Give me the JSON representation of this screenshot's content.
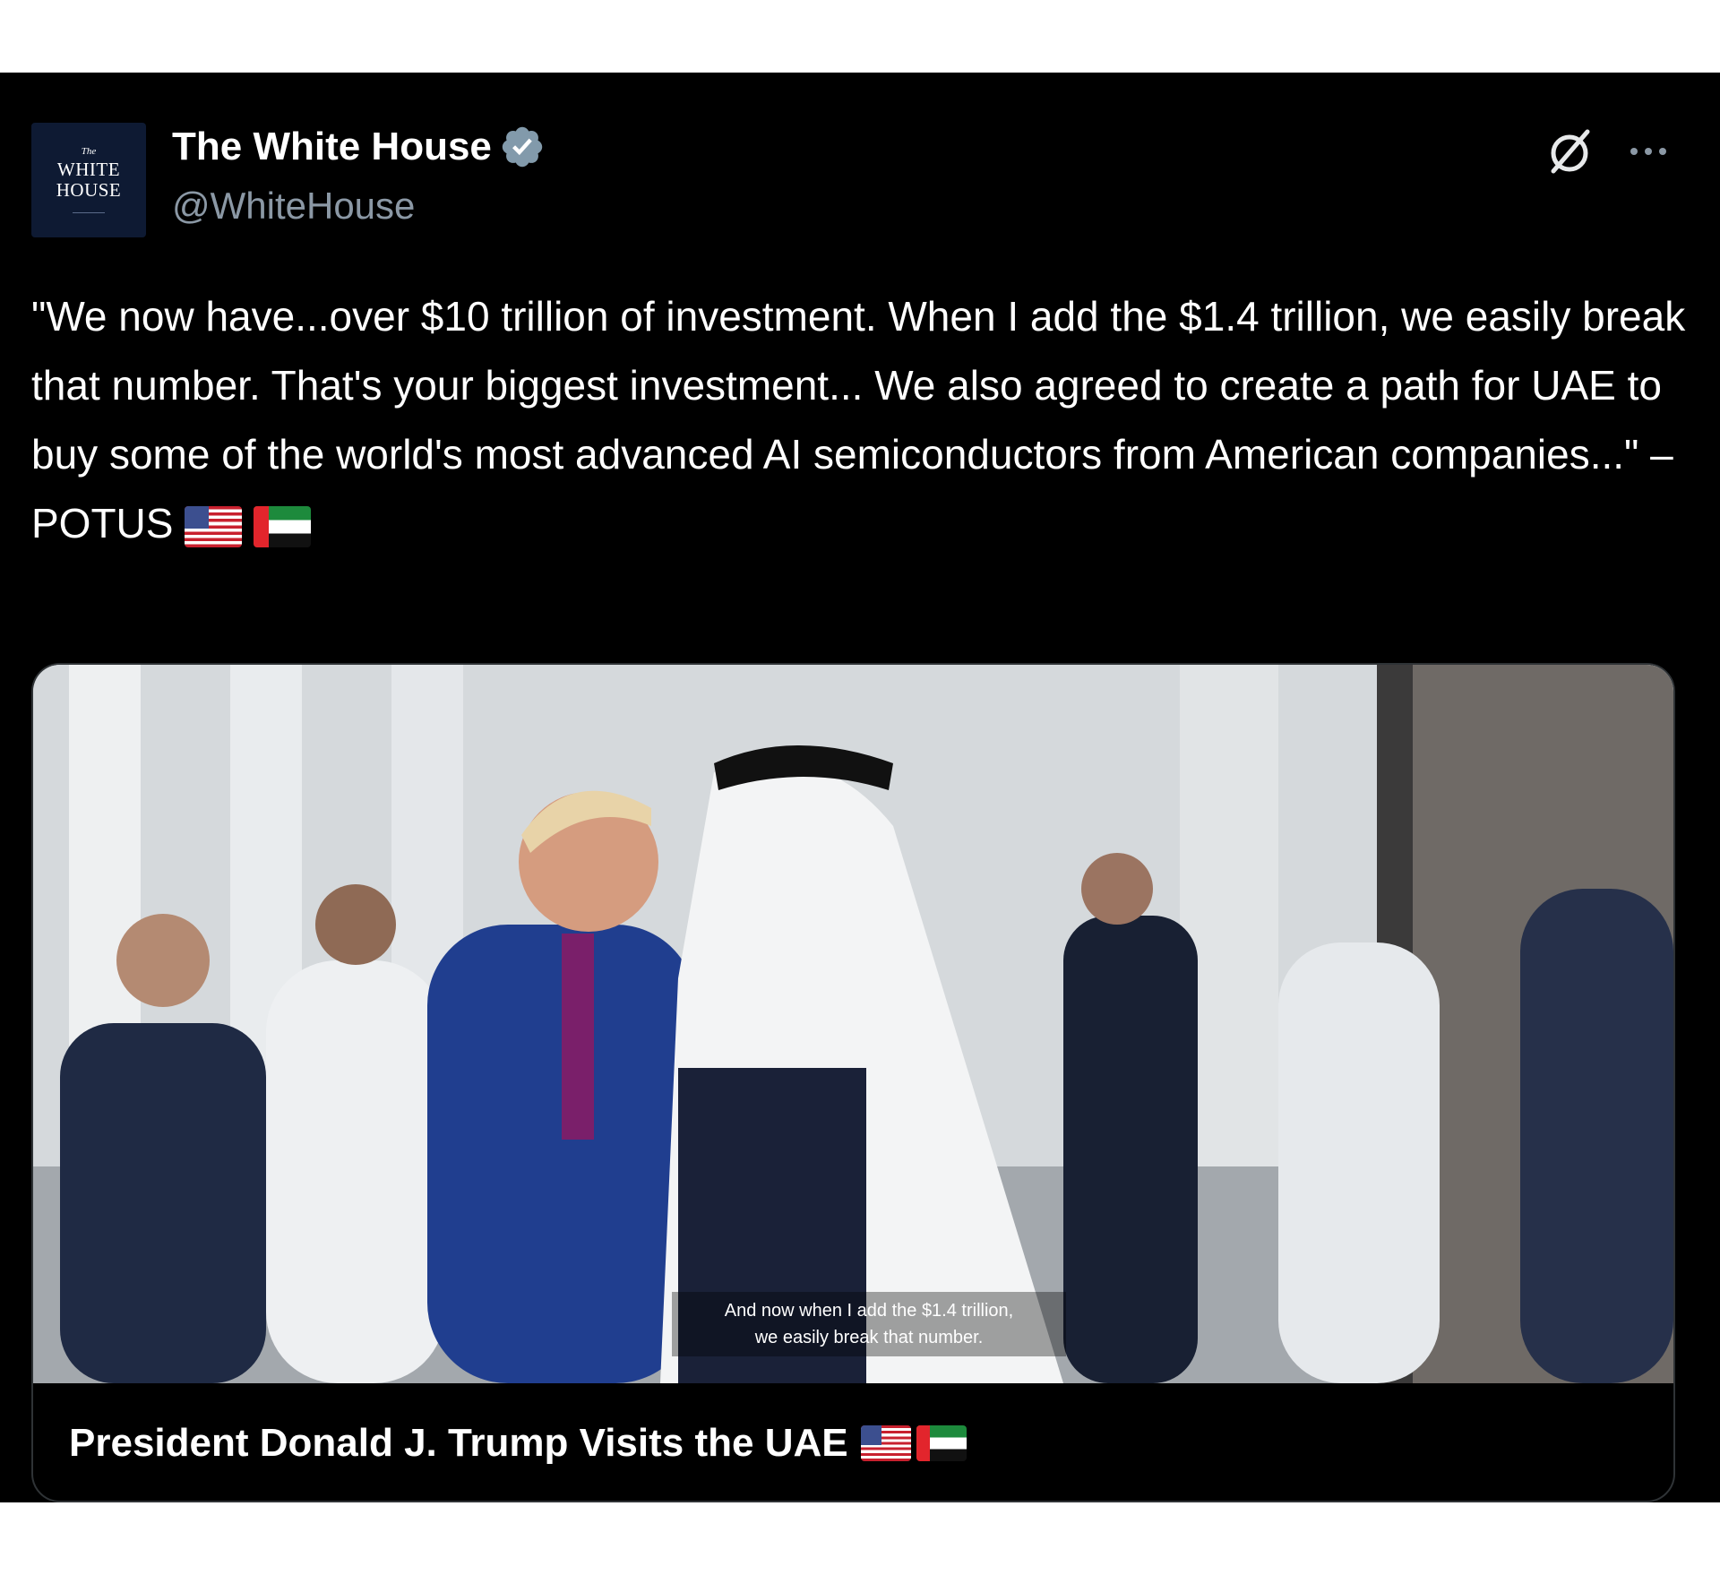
{
  "author": {
    "display_name": "The White House",
    "handle": "@WhiteHouse",
    "verified": true,
    "avatar": {
      "line1": "The",
      "line2": "WHITE",
      "line3": "HOUSE"
    }
  },
  "icons": {
    "grok": "grok-icon",
    "more": "more-icon",
    "verified": "verified-badge-icon",
    "us_flag": "us-flag-emoji",
    "uae_flag": "uae-flag-emoji"
  },
  "tweet": {
    "text": "\"We now have...over $10 trillion of investment. When I add the $1.4 trillion, we easily break that number. That's your biggest investment... We also agreed to create a path for UAE to buy some of the world's most advanced AI semiconductors from American companies...\" –POTUS"
  },
  "card": {
    "subtitle_line1": "And now when I add the $1.4 trillion,",
    "subtitle_line2": "we easily break that number.",
    "title": "President Donald J. Trump Visits the UAE"
  },
  "colors": {
    "background": "#000000",
    "text": "#ffffff",
    "muted": "#8b98a5",
    "verified": "#829aab",
    "border": "#2f3336"
  }
}
